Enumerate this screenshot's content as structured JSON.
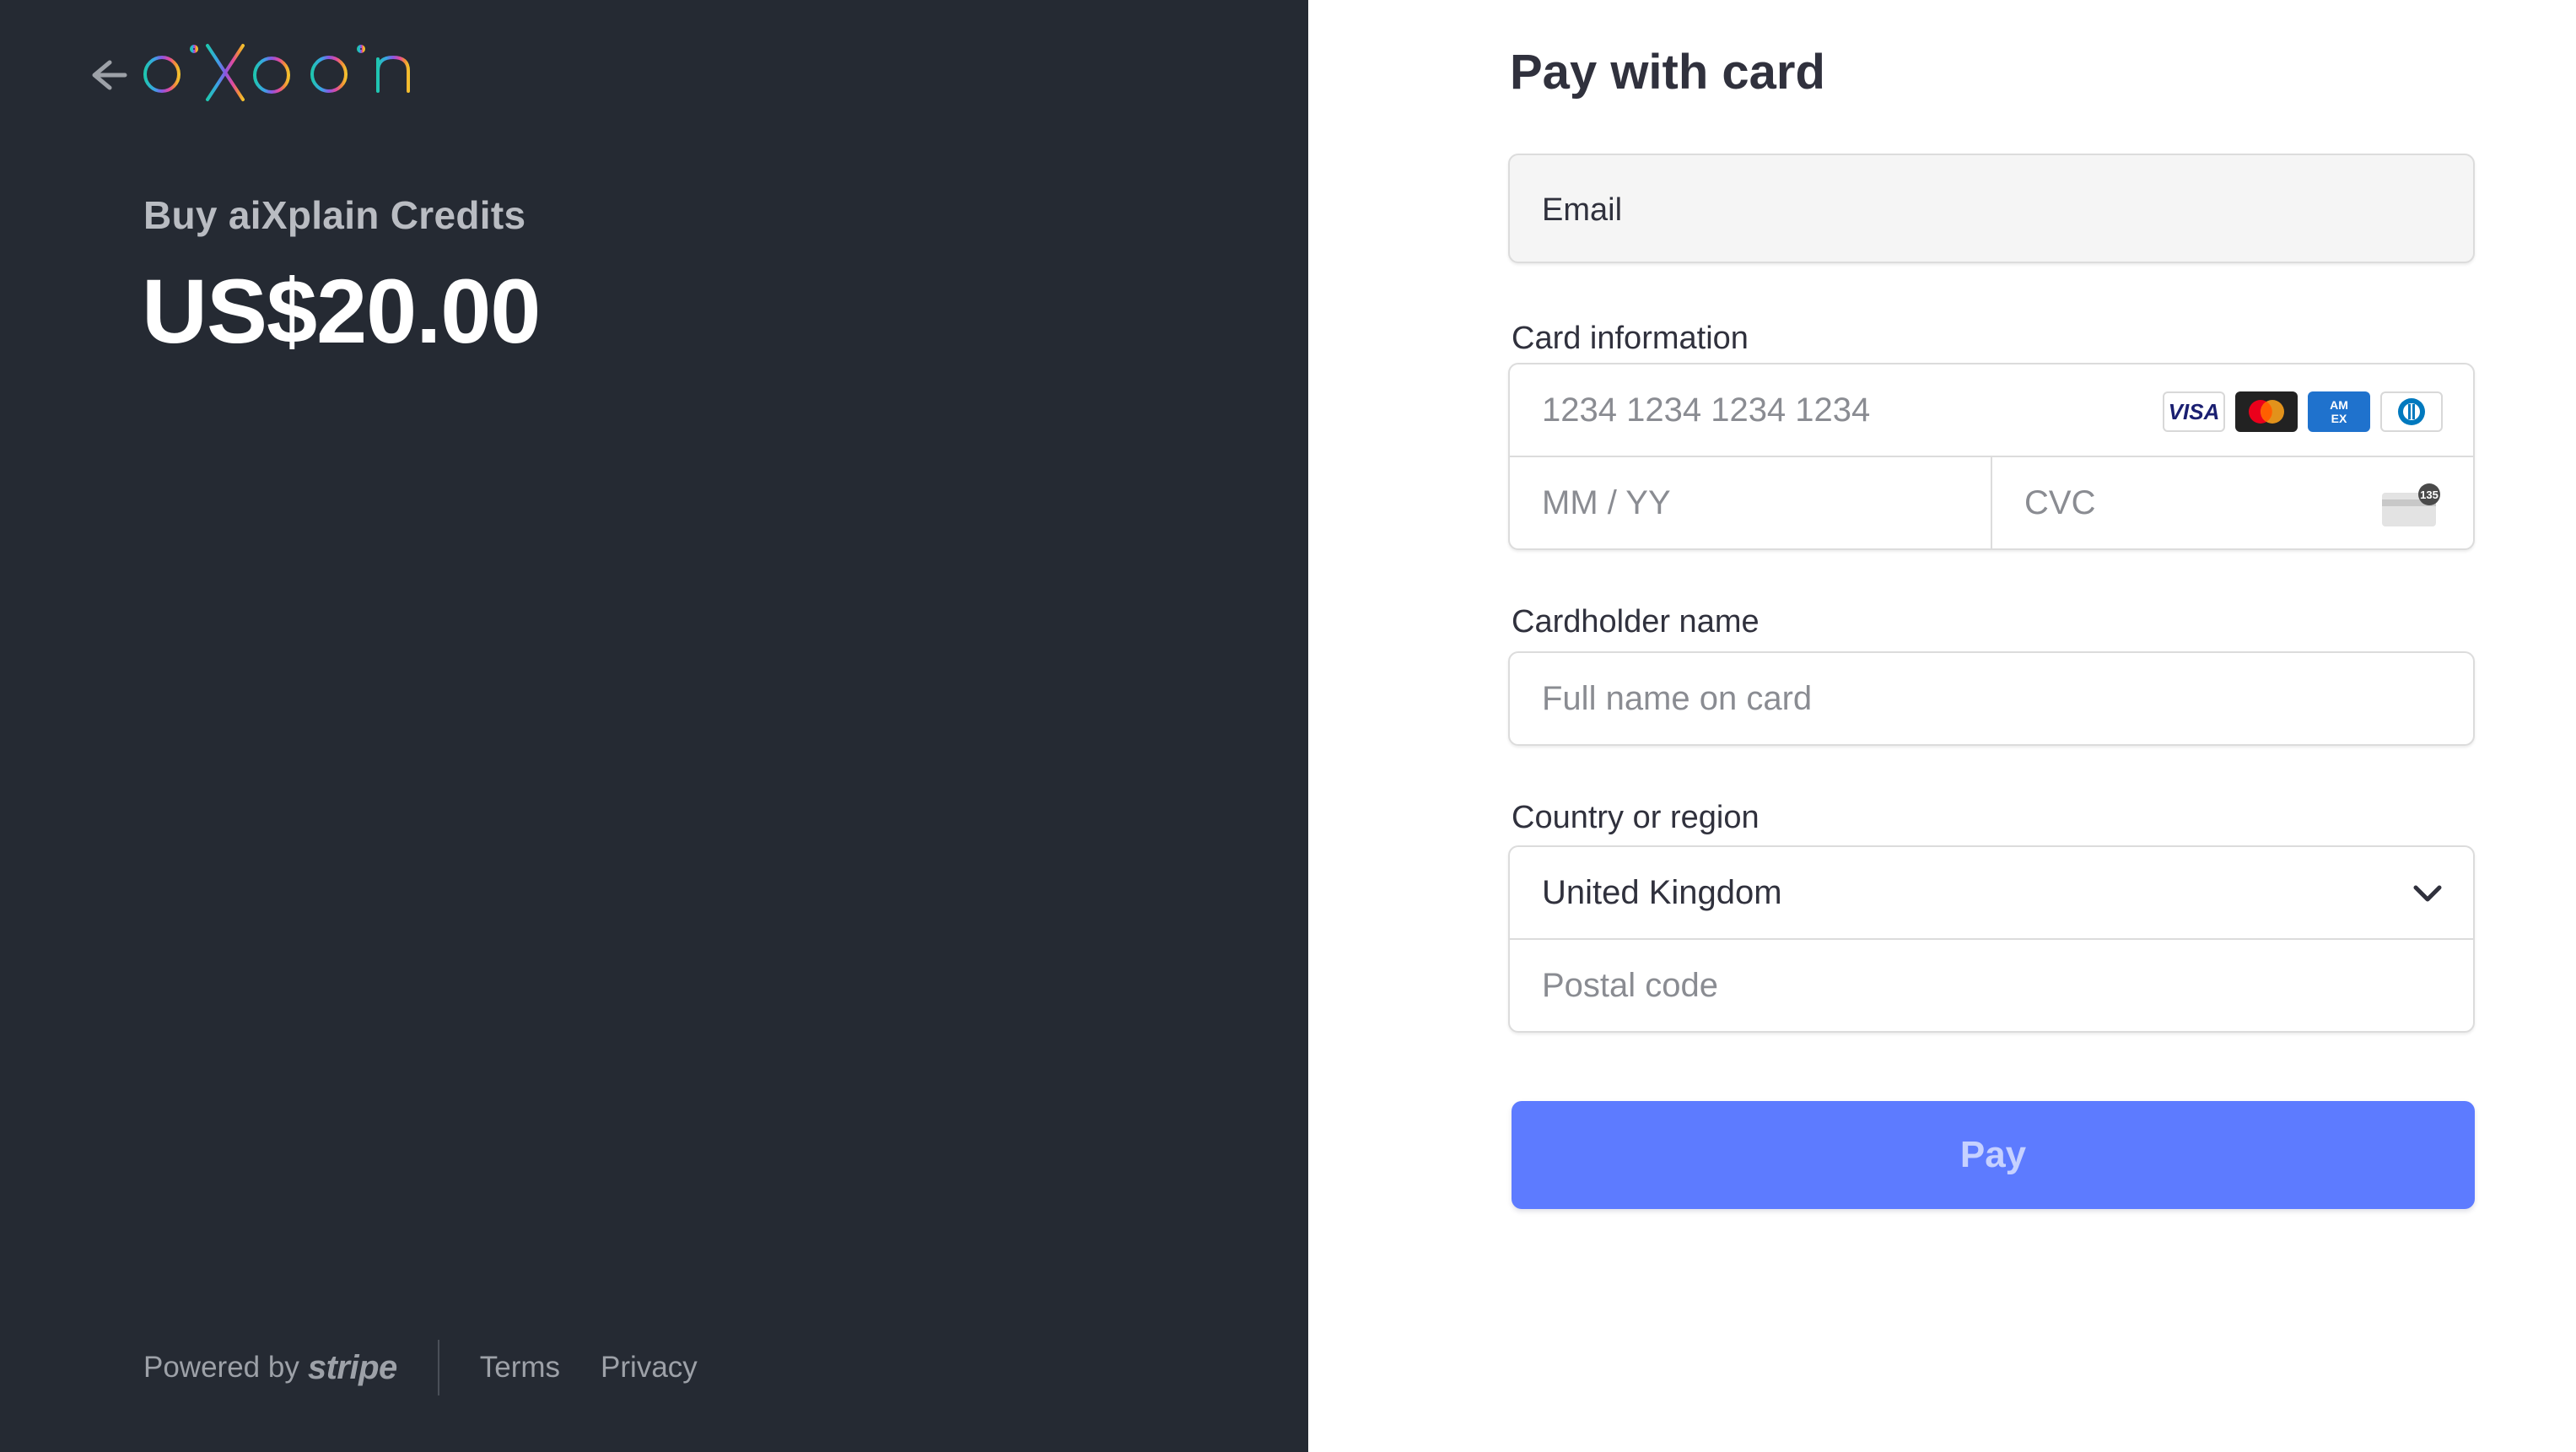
{
  "brand": {
    "logo_text": "aixplain",
    "logo_colors": [
      "#1fc6b0",
      "#3aa3e6",
      "#8a56e2",
      "#e24a9d",
      "#f28c38",
      "#f2c12e"
    ]
  },
  "summary": {
    "product_name": "Buy aiXplain Credits",
    "price": "US$20.00"
  },
  "footer": {
    "powered_by": "Powered by",
    "stripe": "stripe",
    "terms": "Terms",
    "privacy": "Privacy"
  },
  "form": {
    "heading": "Pay with card",
    "email_label": "Email",
    "card_info_label": "Card information",
    "card_number_placeholder": "1234 1234 1234 1234",
    "expiry_placeholder": "MM / YY",
    "cvc_placeholder": "CVC",
    "cvc_badge": "135",
    "card_brands": [
      "VISA",
      "Mastercard",
      "AMEX",
      "Diners"
    ],
    "cardholder_label": "Cardholder name",
    "cardholder_placeholder": "Full name on card",
    "country_label": "Country or region",
    "country_value": "United Kingdom",
    "postal_placeholder": "Postal code",
    "pay_label": "Pay"
  },
  "colors": {
    "left_panel_bg": "#252a33",
    "pay_button": "#5d7bff"
  }
}
